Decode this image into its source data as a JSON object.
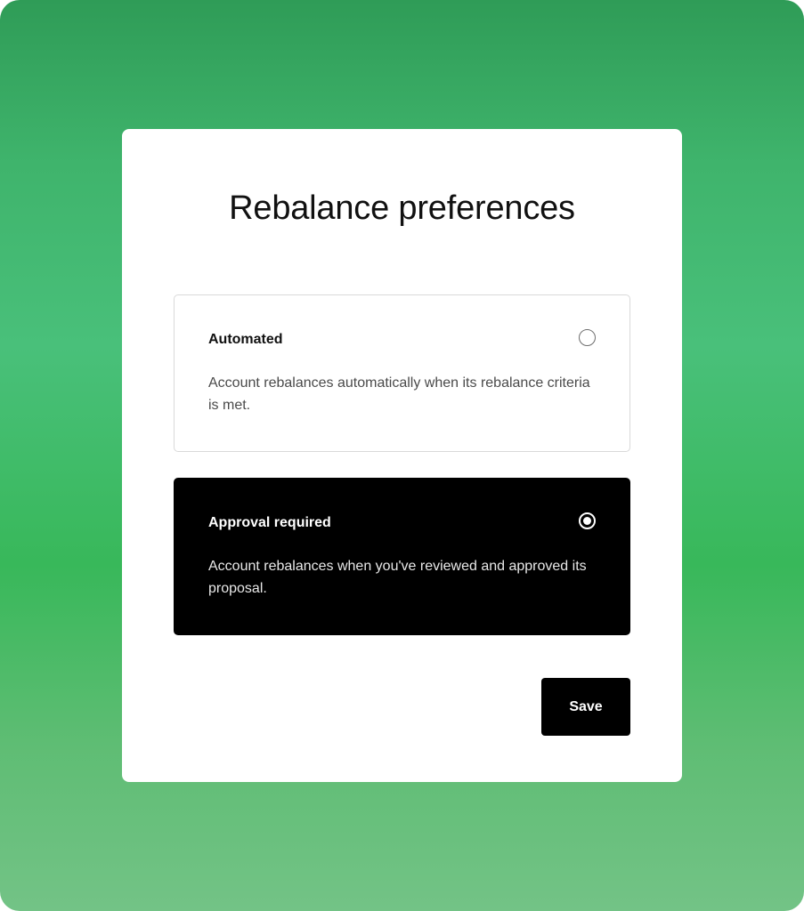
{
  "dialog": {
    "title": "Rebalance preferences"
  },
  "options": [
    {
      "label": "Automated",
      "description": "Account rebalances automatically when its rebalance criteria is met.",
      "selected": false
    },
    {
      "label": "Approval required",
      "description": "Account rebalances when you've reviewed and approved its proposal.",
      "selected": true
    }
  ],
  "actions": {
    "save_label": "Save"
  },
  "colors": {
    "background_green": "#3fb46c",
    "card": "#ffffff",
    "selected_option": "#000000",
    "button": "#000000",
    "button_text": "#ffffff"
  },
  "icons": {
    "unselected": "radio-unchecked-icon",
    "selected": "radio-checked-icon"
  }
}
